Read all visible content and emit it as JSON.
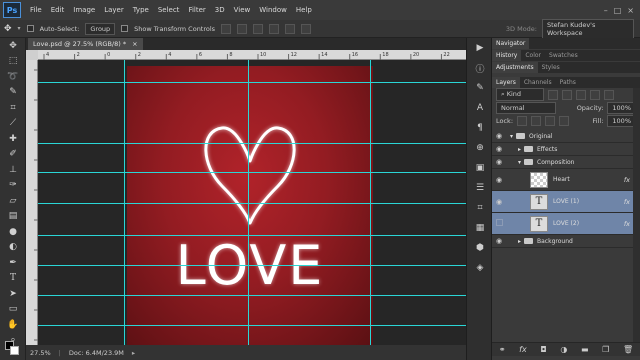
{
  "app": {
    "logo": "Ps"
  },
  "menu": [
    "File",
    "Edit",
    "Image",
    "Layer",
    "Type",
    "Select",
    "Filter",
    "3D",
    "View",
    "Window",
    "Help"
  ],
  "window_controls": [
    "–",
    "□",
    "×"
  ],
  "options": {
    "auto_select_label": "Auto-Select:",
    "auto_select_value": "Group",
    "show_transform_label": "Show Transform Controls",
    "mode_3d_label": "3D Mode:",
    "workspace": "Stefan Kudev's Workspace"
  },
  "document": {
    "tab_title": "Love.psd @ 27.5% (RGB/8) *",
    "tab_close": "×",
    "zoom": "27.5%",
    "doc_size": "Doc: 6.4M/23.9M",
    "artwork_text": "LOVE"
  },
  "ruler": {
    "top_labels": [
      "4",
      "2",
      "0",
      "2",
      "4",
      "6",
      "8",
      "10",
      "12",
      "14",
      "16",
      "18",
      "20",
      "22"
    ]
  },
  "panels": {
    "navigator_tab": "Navigator",
    "history_tabs": [
      "History",
      "Color",
      "Swatches"
    ],
    "adjust_tabs": [
      "Adjustments",
      "Styles"
    ],
    "layers_tabs": [
      "Layers",
      "Channels",
      "Paths"
    ],
    "filter_kind": "Kind",
    "blend_mode": "Normal",
    "opacity_label": "Opacity:",
    "opacity_value": "100%",
    "lock_label": "Lock:",
    "fill_label": "Fill:",
    "fill_value": "100%"
  },
  "layers": [
    {
      "name": "Original",
      "kind": "group",
      "indent": 0,
      "visible": true,
      "expanded": true
    },
    {
      "name": "Effects",
      "kind": "group",
      "indent": 1,
      "visible": true,
      "expanded": false
    },
    {
      "name": "Composition",
      "kind": "group",
      "indent": 1,
      "visible": true,
      "expanded": true
    },
    {
      "name": "Heart",
      "kind": "shape",
      "indent": 2,
      "visible": true,
      "fx": "fx"
    },
    {
      "name": "LOVE (1)",
      "kind": "text",
      "indent": 2,
      "visible": true,
      "selected": true,
      "fx": "fx"
    },
    {
      "name": "LOVE (2)",
      "kind": "text",
      "indent": 2,
      "visible": false,
      "selected": true,
      "fx": "fx"
    },
    {
      "name": "Background",
      "kind": "group",
      "indent": 1,
      "visible": true,
      "expanded": false
    }
  ],
  "colors": {
    "accent_guide": "#2ad6d6",
    "selection": "#6f85a8",
    "artwork_red": "#b1232a"
  },
  "icons": {
    "tools": [
      "move-icon",
      "marquee-icon",
      "lasso-icon",
      "quick-select-icon",
      "crop-icon",
      "eyedropper-icon",
      "healing-icon",
      "brush-icon",
      "stamp-icon",
      "history-brush-icon",
      "eraser-icon",
      "gradient-icon",
      "blur-icon",
      "dodge-icon",
      "pen-icon",
      "type-icon",
      "path-select-icon",
      "shape-icon",
      "hand-icon",
      "zoom-icon"
    ]
  }
}
